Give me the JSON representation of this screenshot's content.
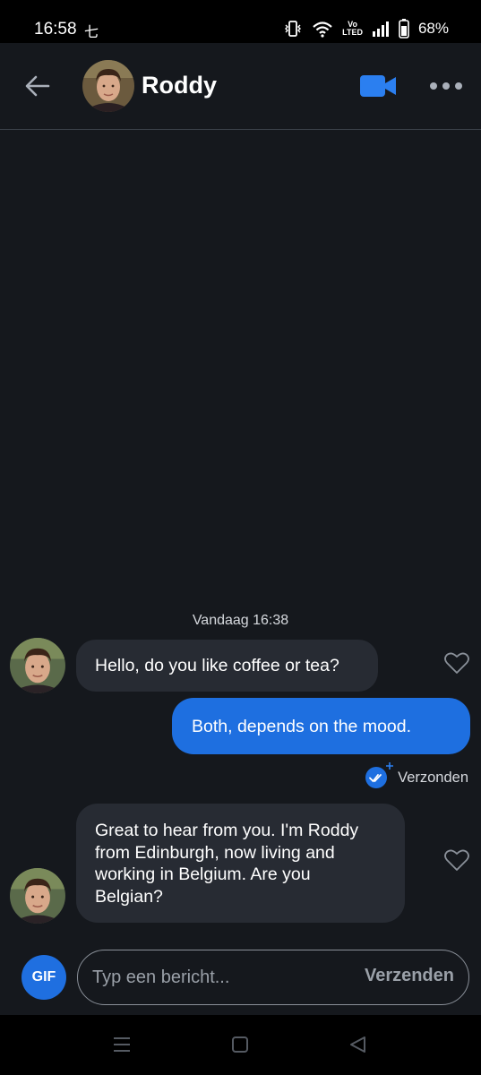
{
  "status_bar": {
    "time": "16:58",
    "notification_glyph": "七",
    "volte_label_top": "Vo",
    "volte_label_bottom": "LTED",
    "battery_percent": "68%",
    "icons": [
      "vibrate-icon",
      "wifi-icon",
      "signal-icon",
      "battery-icon"
    ]
  },
  "header": {
    "contact_name": "Roddy",
    "icons": [
      "back-arrow-icon",
      "video-camera-icon",
      "more-dots-icon"
    ],
    "accent_color": "#2b7ff0"
  },
  "conversation": {
    "date_stamp": "Vandaag 16:38",
    "messages": [
      {
        "direction": "incoming",
        "text": "Hello, do you like coffee or tea?"
      },
      {
        "direction": "outgoing",
        "text": "Both, depends on the mood."
      },
      {
        "direction": "incoming",
        "text": "Great to hear from you. I'm Roddy from Edinburgh, now living and working in Belgium. Are you Belgian?"
      }
    ],
    "sent_status": "Verzonden"
  },
  "composer": {
    "gif_label": "GIF",
    "placeholder": "Typ een bericht...",
    "send_label": "Verzenden"
  },
  "nav_bar": {
    "icons": [
      "recent-apps-icon",
      "home-icon",
      "back-icon"
    ]
  },
  "colors": {
    "background": "#15181d",
    "incoming_bubble": "#272b33",
    "outgoing_bubble": "#1e6fe0"
  }
}
